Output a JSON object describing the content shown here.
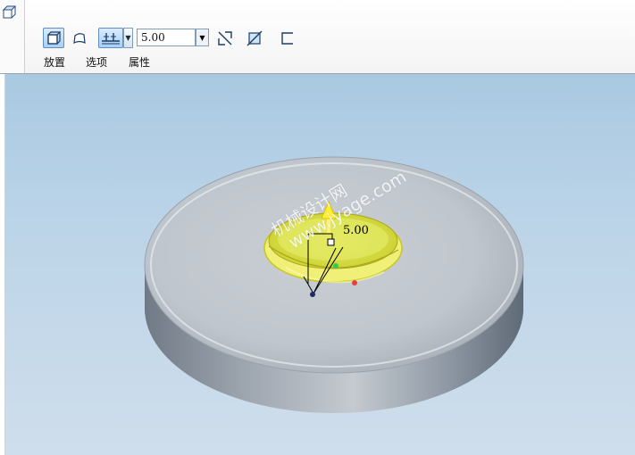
{
  "toolbar": {
    "depth_value": "5.00",
    "placement_tab": "放置",
    "options_tab": "选项",
    "properties_tab": "属性"
  },
  "model": {
    "dimension_label": "5.00"
  },
  "watermark": {
    "line1": "机械设计网",
    "line2": "www.jyage.com"
  },
  "colors": {
    "viewport_top": "#a9c9e2",
    "part_face": "#c8ccd0",
    "part_side": "#7d8794",
    "preview_yellow": "#f2f25a"
  }
}
